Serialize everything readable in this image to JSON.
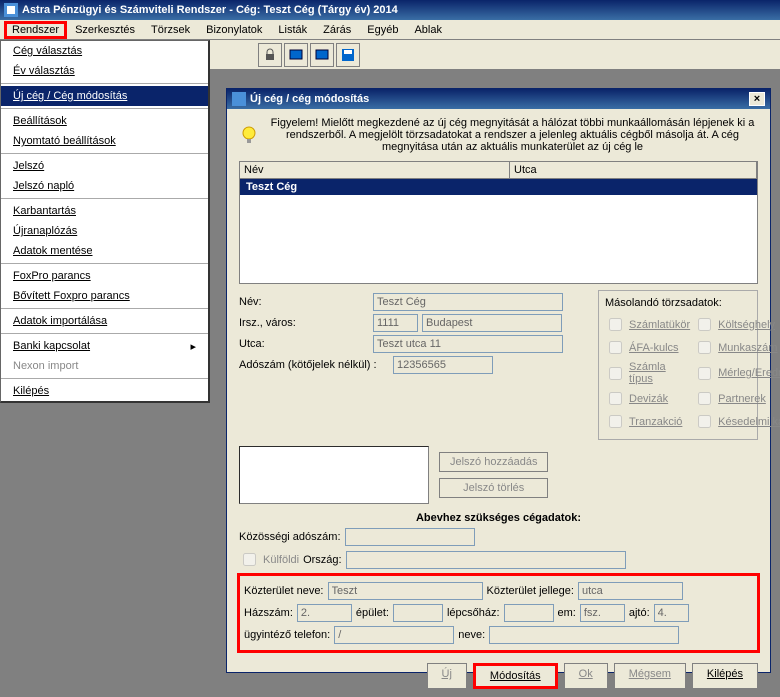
{
  "title": "Astra Pénzügyi és Számviteli Rendszer - Cég: Teszt Cég (Tárgy év) 2014",
  "menubar": [
    "Rendszer",
    "Szerkesztés",
    "Törzsek",
    "Bizonylatok",
    "Listák",
    "Zárás",
    "Egyéb",
    "Ablak"
  ],
  "dropdown": {
    "items": [
      {
        "t": "Cég választás"
      },
      {
        "t": "Év választás"
      },
      {
        "sep": true
      },
      {
        "t": "Új cég / Cég módosítás",
        "sel": true
      },
      {
        "sep": true
      },
      {
        "t": "Beállítások"
      },
      {
        "t": "Nyomtató beállítások"
      },
      {
        "sep": true
      },
      {
        "t": "Jelszó"
      },
      {
        "t": "Jelszó napló"
      },
      {
        "sep": true
      },
      {
        "t": "Karbantartás"
      },
      {
        "t": "Újranaplózás"
      },
      {
        "t": "Adatok mentése"
      },
      {
        "sep": true
      },
      {
        "t": "FoxPro parancs"
      },
      {
        "t": "Bővített Foxpro parancs"
      },
      {
        "sep": true
      },
      {
        "t": "Adatok importálása"
      },
      {
        "sep": true
      },
      {
        "t": "Banki kapcsolat",
        "arrow": true
      },
      {
        "t": "Nexon import",
        "disabled": true
      },
      {
        "sep": true
      },
      {
        "t": "Kilépés"
      }
    ]
  },
  "iwin": {
    "title": "Új cég / cég módosítás",
    "notice": "Figyelem! Mielőtt megkezdené az új cég megnyitását a hálózat többi munkaállomásán lépjenek ki a rendszerből. A megjelölt törzsadatokat a rendszer a jelenleg aktuális cégből másolja át. A cég megnyitása után az aktuális munkaterület az új cég le",
    "list": {
      "cols": [
        "Név",
        "Utca"
      ],
      "row": "Teszt Cég"
    },
    "form": {
      "nev_label": "Név:",
      "nev": "Teszt Cég",
      "irsz_label": "Irsz., város:",
      "irsz": "1111",
      "varos": "Budapest",
      "utca_label": "Utca:",
      "utca": "Teszt utca 11",
      "adoszam_label": "Adószám (kötőjelek nélkül) :",
      "adoszam": "12356565"
    },
    "copy": {
      "title": "Másolandó törzsadatok:",
      "items": [
        "Számlatükör",
        "Költséghely",
        "ÁFA-kulcs",
        "Munkaszám",
        "Számla típus",
        "Mérleg/Eredmény",
        "Devizák",
        "Partnerek",
        "Tranzakció",
        "Késedelmi kamat"
      ]
    },
    "pw": {
      "add": "Jelszó hozzáadás",
      "del": "Jelszó törlés"
    },
    "abev_title": "Abevhez szükséges cégadatok:",
    "sec2": {
      "koz_ado": "Közösségi adószám:",
      "kulfoldi": "Külföldi",
      "orszag": "Ország:",
      "kozt_nev_lab": "Közterület neve:",
      "kozt_nev": "Teszt",
      "kozt_jel_lab": "Közterület jellege:",
      "kozt_jel": "utca",
      "hazszam_lab": "Házszám:",
      "hazszam": "2.",
      "epulet_lab": "épület:",
      "lepcso_lab": "lépcsőház:",
      "em_lab": "em:",
      "em": "fsz.",
      "ajto_lab": "ajtó:",
      "ajto": "4.",
      "ugyintezo_lab": "ügyintéző telefon:",
      "ugyintezo": "/",
      "neve_lab": "neve:"
    },
    "buttons": {
      "uj": "Új",
      "mod": "Módosítás",
      "ok": "Ok",
      "megsem": "Mégsem",
      "kilepes": "Kilépés"
    }
  }
}
